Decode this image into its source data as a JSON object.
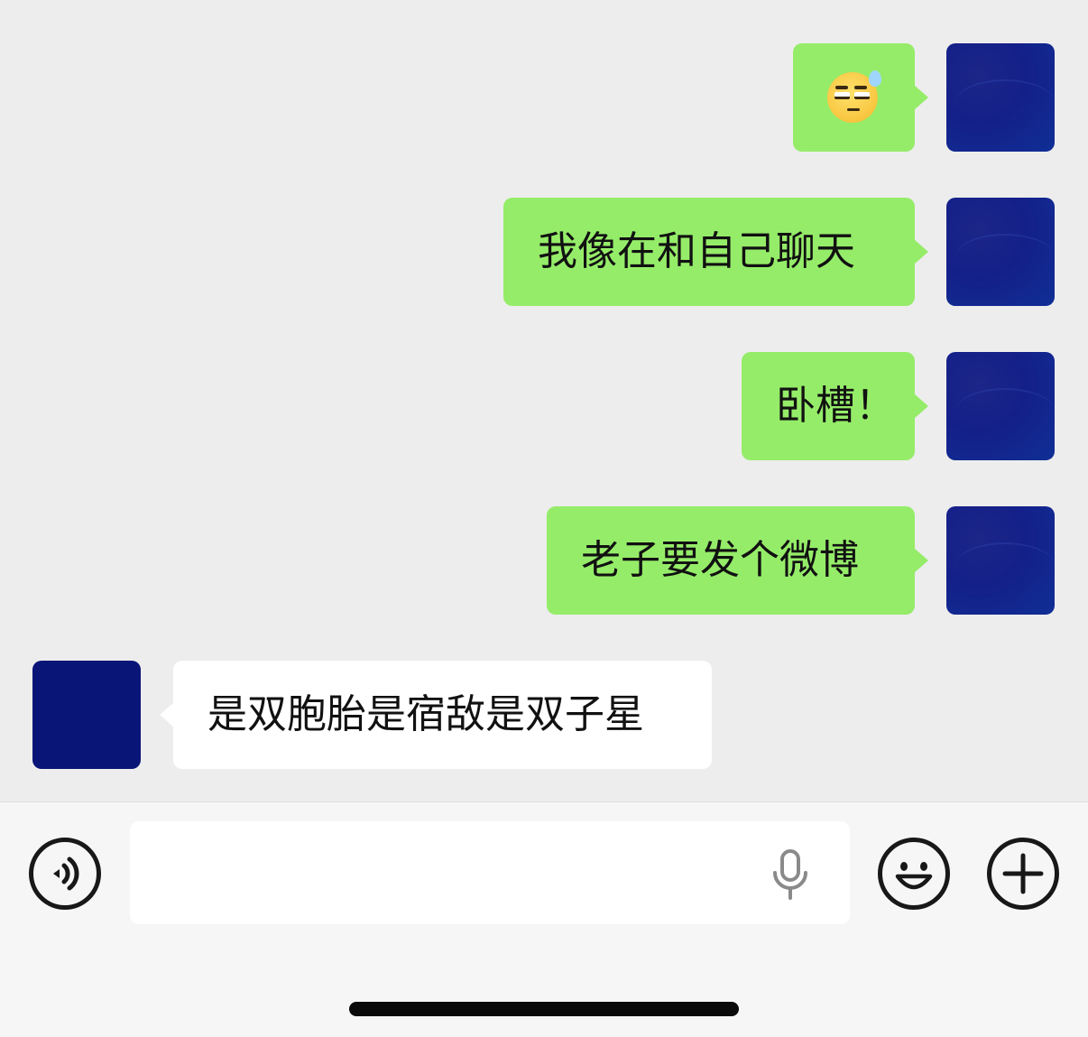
{
  "messages": [
    {
      "sender": "me",
      "type": "emoji",
      "emoji_name": "sweat-smile-sideeye-icon"
    },
    {
      "sender": "me",
      "type": "text",
      "text": "我像在和自己聊天"
    },
    {
      "sender": "me",
      "type": "text",
      "text": "卧槽！"
    },
    {
      "sender": "me",
      "type": "text",
      "text": "老子要发个微博"
    },
    {
      "sender": "other",
      "type": "text",
      "text": "是双胞胎是宿敌是双子星"
    }
  ],
  "input": {
    "value": "",
    "placeholder": ""
  },
  "icons": {
    "voice": "voice-toggle-icon",
    "mic": "microphone-icon",
    "emoji": "emoji-smile-icon",
    "more": "plus-icon"
  },
  "colors": {
    "my_bubble": "#95ec69",
    "their_bubble": "#ffffff",
    "background": "#ededed",
    "self_avatar": "#142089",
    "other_avatar": "#0a1578"
  }
}
